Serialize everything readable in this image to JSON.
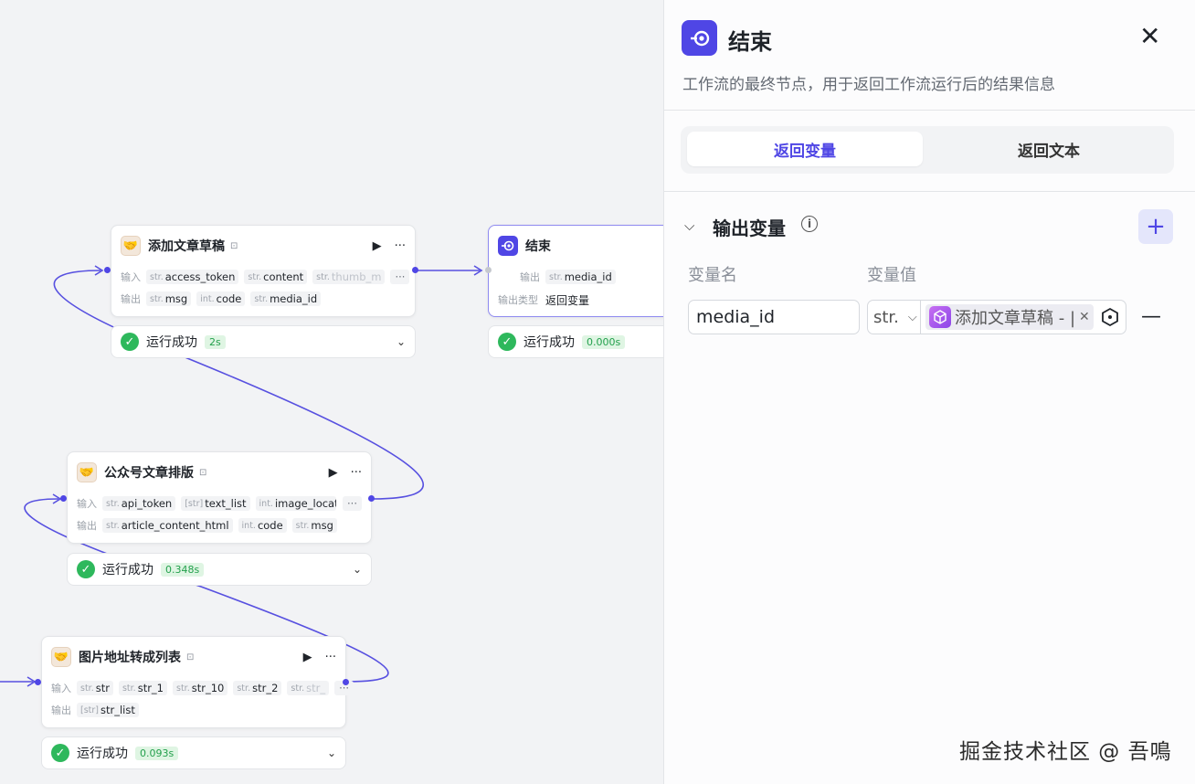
{
  "canvas": {
    "nodes": [
      {
        "title": "添加文章草稿",
        "badge": "⊡",
        "inputs": [
          {
            "type": "str.",
            "name": "access_token"
          },
          {
            "type": "str.",
            "name": "content"
          },
          {
            "type": "str.",
            "name": "thumb_m"
          }
        ],
        "outputs": [
          {
            "type": "str.",
            "name": "msg"
          },
          {
            "type": "int.",
            "name": "code"
          },
          {
            "type": "str.",
            "name": "media_id"
          }
        ],
        "status": "运行成功",
        "time": "2s"
      },
      {
        "title": "结束",
        "output_label": "输出",
        "output_type": "str.",
        "output_name": "media_id",
        "output_kind_label": "输出类型",
        "output_kind": "返回变量",
        "status": "运行成功",
        "time": "0.000s"
      },
      {
        "title": "公众号文章排版",
        "badge": "⊡",
        "inputs": [
          {
            "type": "str.",
            "name": "api_token"
          },
          {
            "type": "[str]",
            "name": "text_list"
          },
          {
            "type": "int.",
            "name": "image_locat"
          }
        ],
        "outputs": [
          {
            "type": "str.",
            "name": "article_content_html"
          },
          {
            "type": "int.",
            "name": "code"
          },
          {
            "type": "str.",
            "name": "msg"
          }
        ],
        "status": "运行成功",
        "time": "0.348s"
      },
      {
        "title": "图片地址转成列表",
        "badge": "⊡",
        "inputs": [
          {
            "type": "str.",
            "name": "str"
          },
          {
            "type": "str.",
            "name": "str_1"
          },
          {
            "type": "str.",
            "name": "str_10"
          },
          {
            "type": "str.",
            "name": "str_2"
          },
          {
            "type": "str.",
            "name": "str_"
          }
        ],
        "outputs": [
          {
            "type": "[str]",
            "name": "str_list"
          }
        ],
        "status": "运行成功",
        "time": "0.093s"
      }
    ],
    "input_label": "输入",
    "output_label": "输出",
    "more": "···"
  },
  "panel": {
    "title": "结束",
    "description": "工作流的最终节点，用于返回工作流运行后的结果信息",
    "tabs": [
      "返回变量",
      "返回文本"
    ],
    "section_title": "输出变量",
    "col_name": "变量名",
    "col_value": "变量值",
    "var_name": "media_id",
    "var_type": "str.",
    "var_ref": "添加文章草稿 - |"
  },
  "watermark": "掘金技术社区 @ 吾鳴",
  "colors": {
    "accent": "#4f46e5",
    "success": "#2eb85c"
  }
}
